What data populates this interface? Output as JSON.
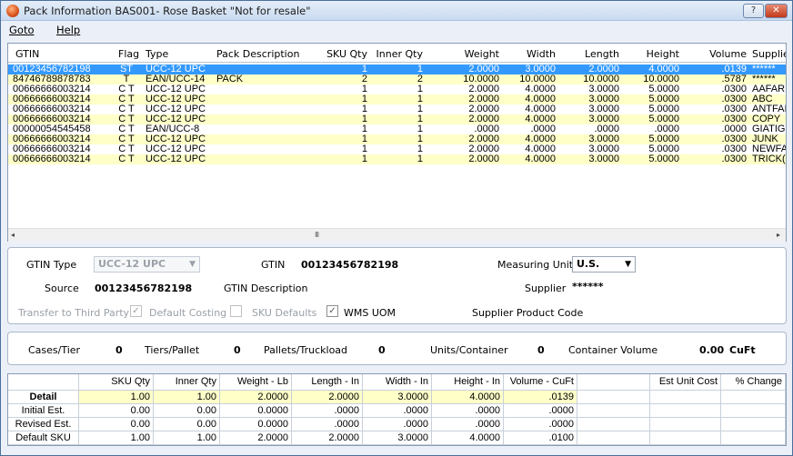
{
  "window": {
    "title": "Pack Information BAS001- Rose Basket \"Not for resale\"",
    "help_button": "?",
    "close_button": "✕"
  },
  "menu": {
    "goto": "Goto",
    "help": "Help"
  },
  "grid": {
    "columns": [
      "GTIN",
      "Flag",
      "Type",
      "Pack Description",
      "SKU Qty",
      "Inner Qty",
      "Weight",
      "Width",
      "Length",
      "Height",
      "Volume",
      "Supplie"
    ],
    "rows": [
      [
        "00123456782198",
        "ST",
        "UCC-12 UPC",
        "",
        "1",
        "1",
        "2.0000",
        "3.0000",
        "2.0000",
        "4.0000",
        ".0139",
        "******"
      ],
      [
        "84746789878783",
        "T",
        "EAN/UCC-14",
        "PACK",
        "2",
        "2",
        "10.0000",
        "10.0000",
        "10.0000",
        "10.0000",
        ".5787",
        "******"
      ],
      [
        "00666666003214",
        "C T",
        "UCC-12 UPC",
        "",
        "1",
        "1",
        "2.0000",
        "4.0000",
        "3.0000",
        "5.0000",
        ".0300",
        "AAFARI"
      ],
      [
        "00666666003214",
        "C T",
        "UCC-12 UPC",
        "",
        "1",
        "1",
        "2.0000",
        "4.0000",
        "3.0000",
        "5.0000",
        ".0300",
        "ABC"
      ],
      [
        "00666666003214",
        "C T",
        "UCC-12 UPC",
        "",
        "1",
        "1",
        "2.0000",
        "4.0000",
        "3.0000",
        "5.0000",
        ".0300",
        "ANTFAI"
      ],
      [
        "00666666003214",
        "C T",
        "UCC-12 UPC",
        "",
        "1",
        "1",
        "2.0000",
        "4.0000",
        "3.0000",
        "5.0000",
        ".0300",
        "COPY"
      ],
      [
        "00000054545458",
        "C T",
        "EAN/UCC-8",
        "",
        "1",
        "1",
        ".0000",
        ".0000",
        ".0000",
        ".0000",
        ".0000",
        "GIATIG"
      ],
      [
        "00666666003214",
        "C T",
        "UCC-12 UPC",
        "",
        "1",
        "1",
        "2.0000",
        "4.0000",
        "3.0000",
        "5.0000",
        ".0300",
        "JUNK"
      ],
      [
        "00666666003214",
        "C T",
        "UCC-12 UPC",
        "",
        "1",
        "1",
        "2.0000",
        "4.0000",
        "3.0000",
        "5.0000",
        ".0300",
        "NEWFA"
      ],
      [
        "00666666003214",
        "C T",
        "UCC-12 UPC",
        "",
        "1",
        "1",
        "2.0000",
        "4.0000",
        "3.0000",
        "5.0000",
        ".0300",
        "TRICK("
      ]
    ],
    "scroll_left": "◂",
    "scroll_right": "▸",
    "scroll_grip": "III"
  },
  "details": {
    "gtin_type_label": "GTIN Type",
    "gtin_type_value": "UCC-12 UPC",
    "gtin_label": "GTIN",
    "gtin_value": "00123456782198",
    "measuring_units_label": "Measuring Units",
    "measuring_units_value": "U.S.",
    "source_label": "Source",
    "source_value": "00123456782198",
    "gtin_description_label": "GTIN Description",
    "supplier_label": "Supplier",
    "supplier_value": "******",
    "transfer_label": "Transfer to Third Party",
    "default_costing_label": "Default Costing",
    "sku_defaults_label": "SKU Defaults",
    "wms_uom_label": "WMS UOM",
    "supplier_product_code_label": "Supplier Product Code",
    "check_mark": "✓"
  },
  "pallet": {
    "cases_tier_label": "Cases/Tier",
    "cases_tier_value": "0",
    "tiers_pallet_label": "Tiers/Pallet",
    "tiers_pallet_value": "0",
    "pallets_truckload_label": "Pallets/Truckload",
    "pallets_truckload_value": "0",
    "units_container_label": "Units/Container",
    "units_container_value": "0",
    "container_volume_label": "Container Volume",
    "container_volume_value": "0.00",
    "container_volume_unit": "CuFt"
  },
  "summary": {
    "columns": [
      "SKU Qty",
      "Inner Qty",
      "Weight - Lb",
      "Length - In",
      "Width - In",
      "Height - In",
      "Volume - CuFt",
      "",
      "Est Unit Cost",
      "% Change"
    ],
    "rows": [
      {
        "label": "Detail",
        "values": [
          "1.00",
          "1.00",
          "2.0000",
          "2.0000",
          "3.0000",
          "4.0000",
          ".0139",
          "",
          "",
          ""
        ]
      },
      {
        "label": "Initial Est.",
        "values": [
          "0.00",
          "0.00",
          "0.0000",
          ".0000",
          ".0000",
          ".0000",
          ".0000",
          "",
          "",
          ""
        ]
      },
      {
        "label": "Revised Est.",
        "values": [
          "0.00",
          "0.00",
          "0.0000",
          ".0000",
          ".0000",
          ".0000",
          ".0000",
          "",
          "",
          ""
        ]
      },
      {
        "label": "Default SKU",
        "values": [
          "1.00",
          "1.00",
          "2.0000",
          "2.0000",
          "3.0000",
          "4.0000",
          ".0100",
          "",
          "",
          ""
        ]
      }
    ]
  }
}
